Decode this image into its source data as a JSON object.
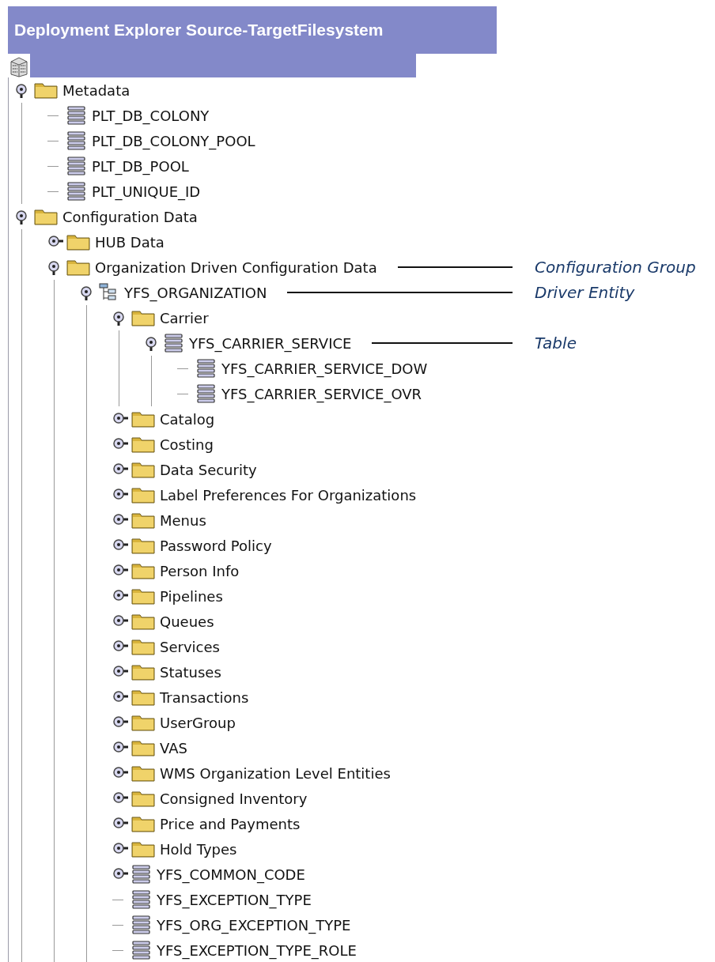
{
  "title": "Deployment Explorer Source-TargetFilesystem",
  "tree": [
    {
      "label": "Metadata",
      "kind": "folder",
      "expanded": true,
      "children": [
        {
          "label": "PLT_DB_COLONY",
          "kind": "table"
        },
        {
          "label": "PLT_DB_COLONY_POOL",
          "kind": "table"
        },
        {
          "label": "PLT_DB_POOL",
          "kind": "table"
        },
        {
          "label": "PLT_UNIQUE_ID",
          "kind": "table"
        }
      ]
    },
    {
      "label": "Configuration Data",
      "kind": "folder",
      "expanded": true,
      "children": [
        {
          "label": "HUB Data",
          "kind": "folder",
          "expanded": false
        },
        {
          "label": "Organization Driven Configuration Data",
          "kind": "folder",
          "expanded": true,
          "callout": "Configuration Group",
          "children": [
            {
              "label": "YFS_ORGANIZATION",
              "kind": "entity",
              "expanded": true,
              "callout": "Driver Entity",
              "children": [
                {
                  "label": "Carrier",
                  "kind": "folder",
                  "expanded": true,
                  "children": [
                    {
                      "label": "YFS_CARRIER_SERVICE",
                      "kind": "table",
                      "expanded": true,
                      "callout": "Table",
                      "children": [
                        {
                          "label": "YFS_CARRIER_SERVICE_DOW",
                          "kind": "table"
                        },
                        {
                          "label": "YFS_CARRIER_SERVICE_OVR",
                          "kind": "table"
                        }
                      ]
                    }
                  ]
                },
                {
                  "label": "Catalog",
                  "kind": "folder",
                  "expanded": false
                },
                {
                  "label": "Costing",
                  "kind": "folder",
                  "expanded": false
                },
                {
                  "label": "Data Security",
                  "kind": "folder",
                  "expanded": false
                },
                {
                  "label": "Label Preferences For Organizations",
                  "kind": "folder",
                  "expanded": false
                },
                {
                  "label": "Menus",
                  "kind": "folder",
                  "expanded": false
                },
                {
                  "label": "Password Policy",
                  "kind": "folder",
                  "expanded": false
                },
                {
                  "label": "Person Info",
                  "kind": "folder",
                  "expanded": false
                },
                {
                  "label": "Pipelines",
                  "kind": "folder",
                  "expanded": false
                },
                {
                  "label": "Queues",
                  "kind": "folder",
                  "expanded": false
                },
                {
                  "label": "Services",
                  "kind": "folder",
                  "expanded": false
                },
                {
                  "label": "Statuses",
                  "kind": "folder",
                  "expanded": false
                },
                {
                  "label": "Transactions",
                  "kind": "folder",
                  "expanded": false
                },
                {
                  "label": "UserGroup",
                  "kind": "folder",
                  "expanded": false
                },
                {
                  "label": "VAS",
                  "kind": "folder",
                  "expanded": false
                },
                {
                  "label": "WMS Organization Level Entities",
                  "kind": "folder",
                  "expanded": false
                },
                {
                  "label": "Consigned Inventory",
                  "kind": "folder",
                  "expanded": false
                },
                {
                  "label": "Price and Payments",
                  "kind": "folder",
                  "expanded": false
                },
                {
                  "label": "Hold Types",
                  "kind": "folder",
                  "expanded": false
                },
                {
                  "label": "YFS_COMMON_CODE",
                  "kind": "table",
                  "expanded": false
                },
                {
                  "label": "YFS_EXCEPTION_TYPE",
                  "kind": "table"
                },
                {
                  "label": "YFS_ORG_EXCEPTION_TYPE",
                  "kind": "table"
                },
                {
                  "label": "YFS_EXCEPTION_TYPE_ROLE",
                  "kind": "table"
                }
              ]
            }
          ]
        }
      ]
    }
  ]
}
